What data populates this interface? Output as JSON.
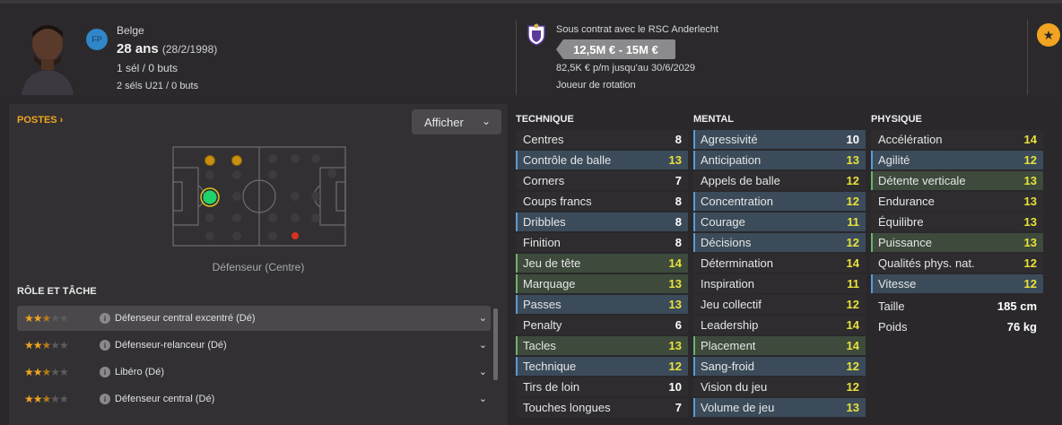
{
  "header": {
    "badge": "FP",
    "nationality": "Belge",
    "age": "28 ans",
    "birthdate": "(28/2/1998)",
    "caps": "1 sél / 0 buts",
    "u21_caps": "2 séls U21 / 0 buts",
    "contract": "Sous contrat avec le RSC Anderlecht",
    "value_range": "12,5M € - 15M €",
    "wage": "82,5K € p/m jusqu'au 30/6/2029",
    "squad_status": "Joueur de rotation"
  },
  "left": {
    "postes_label": "POSTES ›",
    "afficher_label": "Afficher",
    "position_caption": "Défenseur (Centre)",
    "role_title": "RÔLE ET TÂCHE",
    "roles": [
      {
        "label": "Défenseur central excentré (Dé)",
        "stars": 2.5
      },
      {
        "label": "Défenseur-relanceur (Dé)",
        "stars": 2.5
      },
      {
        "label": "Libéro (Dé)",
        "stars": 2.5
      },
      {
        "label": "Défenseur central (Dé)",
        "stars": 2.5
      }
    ]
  },
  "attributes": {
    "technique": {
      "title": "TECHNIQUE",
      "items": [
        {
          "name": "Centres",
          "value": "8",
          "hl": ""
        },
        {
          "name": "Contrôle de balle",
          "value": "13",
          "hl": "blue"
        },
        {
          "name": "Corners",
          "value": "7",
          "hl": ""
        },
        {
          "name": "Coups francs",
          "value": "8",
          "hl": ""
        },
        {
          "name": "Dribbles",
          "value": "8",
          "hl": "blue"
        },
        {
          "name": "Finition",
          "value": "8",
          "hl": ""
        },
        {
          "name": "Jeu de tête",
          "value": "14",
          "hl": "green"
        },
        {
          "name": "Marquage",
          "value": "13",
          "hl": "green"
        },
        {
          "name": "Passes",
          "value": "13",
          "hl": "blue"
        },
        {
          "name": "Penalty",
          "value": "6",
          "hl": ""
        },
        {
          "name": "Tacles",
          "value": "13",
          "hl": "green"
        },
        {
          "name": "Technique",
          "value": "12",
          "hl": "blue"
        },
        {
          "name": "Tirs de loin",
          "value": "10",
          "hl": ""
        },
        {
          "name": "Touches longues",
          "value": "7",
          "hl": ""
        }
      ]
    },
    "mental": {
      "title": "MENTAL",
      "items": [
        {
          "name": "Agressivité",
          "value": "10",
          "hl": "blue"
        },
        {
          "name": "Anticipation",
          "value": "13",
          "hl": "blue"
        },
        {
          "name": "Appels de balle",
          "value": "12",
          "hl": ""
        },
        {
          "name": "Concentration",
          "value": "12",
          "hl": "blue"
        },
        {
          "name": "Courage",
          "value": "11",
          "hl": "blue"
        },
        {
          "name": "Décisions",
          "value": "12",
          "hl": "blue"
        },
        {
          "name": "Détermination",
          "value": "14",
          "hl": ""
        },
        {
          "name": "Inspiration",
          "value": "11",
          "hl": ""
        },
        {
          "name": "Jeu collectif",
          "value": "12",
          "hl": ""
        },
        {
          "name": "Leadership",
          "value": "14",
          "hl": ""
        },
        {
          "name": "Placement",
          "value": "14",
          "hl": "green"
        },
        {
          "name": "Sang-froid",
          "value": "12",
          "hl": "blue"
        },
        {
          "name": "Vision du jeu",
          "value": "12",
          "hl": ""
        },
        {
          "name": "Volume de jeu",
          "value": "13",
          "hl": "blue"
        }
      ]
    },
    "physique": {
      "title": "PHYSIQUE",
      "items": [
        {
          "name": "Accélération",
          "value": "14",
          "hl": ""
        },
        {
          "name": "Agilité",
          "value": "12",
          "hl": "blue"
        },
        {
          "name": "Détente verticale",
          "value": "13",
          "hl": "green"
        },
        {
          "name": "Endurance",
          "value": "13",
          "hl": ""
        },
        {
          "name": "Équilibre",
          "value": "13",
          "hl": ""
        },
        {
          "name": "Puissance",
          "value": "13",
          "hl": "green"
        },
        {
          "name": "Qualités phys. nat.",
          "value": "12",
          "hl": ""
        },
        {
          "name": "Vitesse",
          "value": "12",
          "hl": "blue"
        }
      ],
      "taille_label": "Taille",
      "taille_value": "185 cm",
      "poids_label": "Poids",
      "poids_value": "76 kg"
    }
  }
}
